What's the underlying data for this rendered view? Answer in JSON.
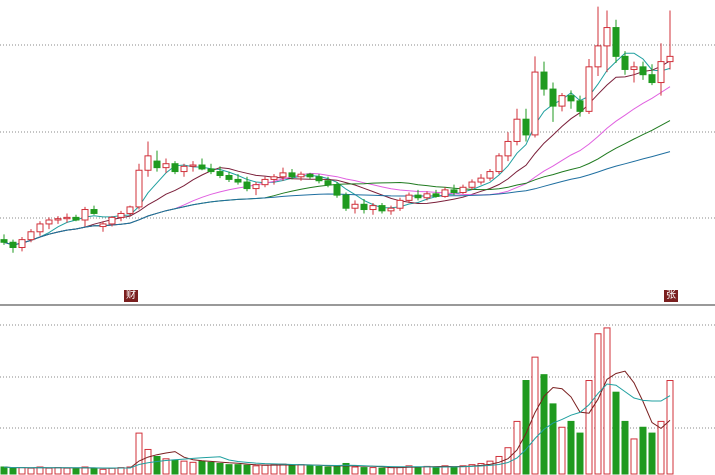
{
  "chart_data": [
    {
      "type": "candlestick",
      "panel": "price",
      "candles": [
        [
          3.3,
          3.34,
          3.26,
          3.28
        ],
        [
          3.28,
          3.3,
          3.2,
          3.24
        ],
        [
          3.24,
          3.32,
          3.21,
          3.3
        ],
        [
          3.3,
          3.38,
          3.28,
          3.36
        ],
        [
          3.36,
          3.44,
          3.33,
          3.42
        ],
        [
          3.42,
          3.47,
          3.38,
          3.45
        ],
        [
          3.45,
          3.48,
          3.42,
          3.46
        ],
        [
          3.46,
          3.5,
          3.43,
          3.47
        ],
        [
          3.47,
          3.49,
          3.44,
          3.45
        ],
        [
          3.45,
          3.55,
          3.4,
          3.53
        ],
        [
          3.53,
          3.56,
          3.49,
          3.5
        ],
        [
          3.4,
          3.44,
          3.36,
          3.42
        ],
        [
          3.42,
          3.48,
          3.4,
          3.47
        ],
        [
          3.47,
          3.52,
          3.44,
          3.5
        ],
        [
          3.5,
          3.56,
          3.48,
          3.55
        ],
        [
          3.55,
          3.88,
          3.53,
          3.83
        ],
        [
          3.83,
          4.05,
          3.78,
          3.94
        ],
        [
          3.9,
          3.98,
          3.82,
          3.85
        ],
        [
          3.85,
          3.92,
          3.81,
          3.88
        ],
        [
          3.88,
          3.9,
          3.8,
          3.82
        ],
        [
          3.82,
          3.88,
          3.78,
          3.86
        ],
        [
          3.86,
          3.9,
          3.82,
          3.87
        ],
        [
          3.87,
          3.92,
          3.83,
          3.84
        ],
        [
          3.84,
          3.88,
          3.8,
          3.82
        ],
        [
          3.82,
          3.86,
          3.77,
          3.79
        ],
        [
          3.79,
          3.82,
          3.74,
          3.76
        ],
        [
          3.76,
          3.8,
          3.72,
          3.74
        ],
        [
          3.74,
          3.78,
          3.67,
          3.69
        ],
        [
          3.69,
          3.74,
          3.64,
          3.72
        ],
        [
          3.72,
          3.78,
          3.7,
          3.76
        ],
        [
          3.76,
          3.8,
          3.72,
          3.78
        ],
        [
          3.78,
          3.85,
          3.75,
          3.81
        ],
        [
          3.81,
          3.84,
          3.76,
          3.78
        ],
        [
          3.78,
          3.82,
          3.75,
          3.8
        ],
        [
          3.8,
          3.81,
          3.76,
          3.78
        ],
        [
          3.78,
          3.8,
          3.73,
          3.75
        ],
        [
          3.75,
          3.78,
          3.7,
          3.72
        ],
        [
          3.72,
          3.74,
          3.62,
          3.64
        ],
        [
          3.64,
          3.66,
          3.52,
          3.54
        ],
        [
          3.54,
          3.6,
          3.5,
          3.57
        ],
        [
          3.57,
          3.61,
          3.5,
          3.53
        ],
        [
          3.53,
          3.58,
          3.49,
          3.56
        ],
        [
          3.56,
          3.58,
          3.5,
          3.52
        ],
        [
          3.52,
          3.56,
          3.49,
          3.54
        ],
        [
          3.54,
          3.62,
          3.52,
          3.6
        ],
        [
          3.6,
          3.66,
          3.58,
          3.64
        ],
        [
          3.64,
          3.68,
          3.6,
          3.62
        ],
        [
          3.62,
          3.67,
          3.6,
          3.65
        ],
        [
          3.65,
          3.68,
          3.62,
          3.63
        ],
        [
          3.63,
          3.7,
          3.62,
          3.68
        ],
        [
          3.68,
          3.72,
          3.64,
          3.66
        ],
        [
          3.66,
          3.72,
          3.65,
          3.7
        ],
        [
          3.7,
          3.76,
          3.68,
          3.74
        ],
        [
          3.74,
          3.8,
          3.72,
          3.77
        ],
        [
          3.77,
          3.84,
          3.75,
          3.82
        ],
        [
          3.82,
          3.96,
          3.8,
          3.94
        ],
        [
          3.94,
          4.12,
          3.9,
          4.05
        ],
        [
          4.05,
          4.3,
          4.02,
          4.22
        ],
        [
          4.22,
          4.3,
          4.05,
          4.1
        ],
        [
          4.1,
          4.7,
          4.08,
          4.58
        ],
        [
          4.58,
          4.66,
          4.4,
          4.45
        ],
        [
          4.45,
          4.5,
          4.2,
          4.32
        ],
        [
          4.32,
          4.42,
          4.28,
          4.4
        ],
        [
          4.4,
          4.44,
          4.3,
          4.36
        ],
        [
          4.36,
          4.4,
          4.24,
          4.28
        ],
        [
          4.28,
          4.68,
          4.26,
          4.62
        ],
        [
          4.62,
          5.08,
          4.55,
          4.78
        ],
        [
          4.78,
          5.05,
          4.58,
          4.92
        ],
        [
          4.92,
          4.98,
          4.65,
          4.7
        ],
        [
          4.7,
          4.74,
          4.56,
          4.6
        ],
        [
          4.6,
          4.66,
          4.5,
          4.62
        ],
        [
          4.62,
          4.66,
          4.52,
          4.56
        ],
        [
          4.56,
          4.64,
          4.48,
          4.5
        ],
        [
          4.5,
          4.8,
          4.4,
          4.66
        ],
        [
          4.66,
          5.05,
          4.6,
          4.7
        ]
      ],
      "moving_averages": [
        {
          "period": 5,
          "color": "#20a0a0"
        },
        {
          "period": 10,
          "color": "#7a1f3a"
        },
        {
          "period": 20,
          "color": "#e060e0"
        },
        {
          "period": 30,
          "color": "#1f7a1f"
        },
        {
          "period": 60,
          "color": "#1f6fa0"
        }
      ],
      "gridlines": 3,
      "markers": [
        {
          "candle": 14,
          "text": "财"
        },
        {
          "candle": 74,
          "text": "张"
        }
      ]
    },
    {
      "type": "bar",
      "panel": "volume",
      "values": [
        12,
        10,
        11,
        10,
        12,
        10,
        11,
        10,
        9,
        12,
        10,
        8,
        10,
        11,
        12,
        70,
        42,
        30,
        26,
        24,
        22,
        20,
        22,
        20,
        18,
        16,
        16,
        15,
        14,
        15,
        16,
        17,
        15,
        16,
        14,
        13,
        12,
        14,
        18,
        12,
        11,
        11,
        10,
        11,
        12,
        14,
        12,
        13,
        12,
        14,
        12,
        14,
        16,
        18,
        22,
        30,
        45,
        90,
        160,
        200,
        170,
        120,
        80,
        90,
        70,
        160,
        240,
        250,
        140,
        90,
        60,
        80,
        70,
        90,
        160
      ],
      "moving_averages": [
        {
          "period": 5,
          "color": "#7a1f1f"
        },
        {
          "period": 10,
          "color": "#20a0a0"
        }
      ],
      "gridlines": 3
    }
  ],
  "style": {
    "up_color": "#d0303a",
    "down_color": "#1f9a1f",
    "grid_color": "#8a8a8a",
    "axis_color": "#333333"
  }
}
